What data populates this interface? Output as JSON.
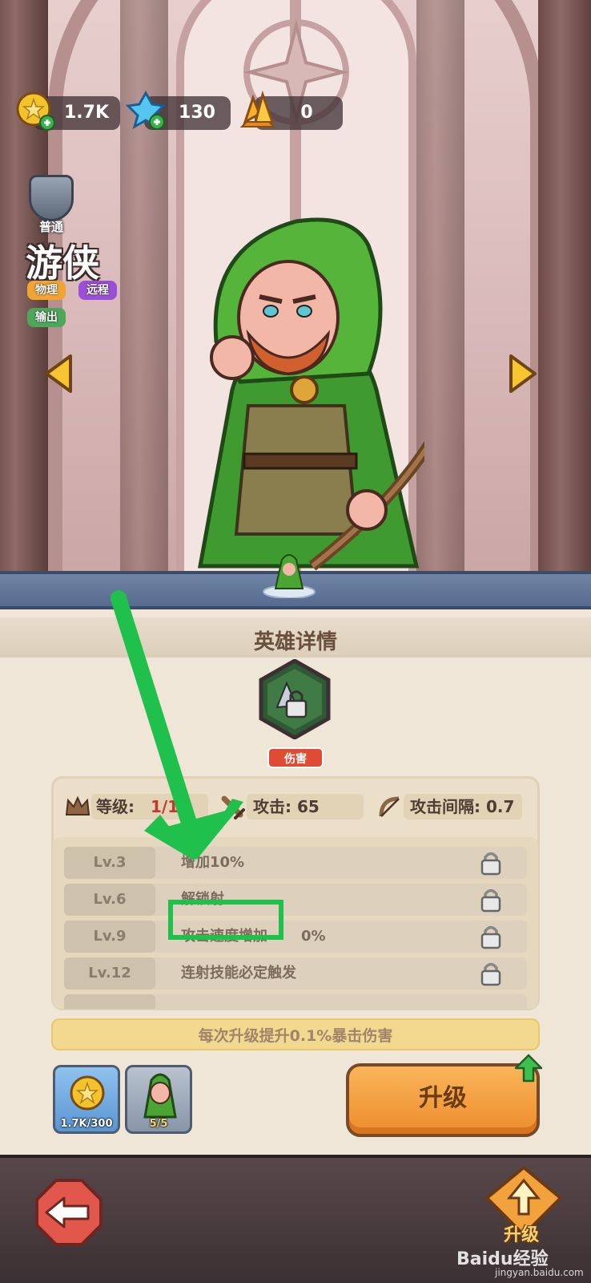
{
  "resources": {
    "gold": "1.7K",
    "gems": "130",
    "crystals": "0"
  },
  "hero": {
    "rank": "普通",
    "name": "游侠",
    "tags": [
      "物理",
      "远程",
      "输出"
    ]
  },
  "panel": {
    "title": "英雄详情",
    "skill_tag": "伤害",
    "stats": {
      "level_label": "等级:",
      "level_value": "1/1",
      "attack": "攻击: 65",
      "interval": "攻击间隔: 0.7"
    },
    "levels": [
      {
        "lv": "Lv.3",
        "desc": "增加10%"
      },
      {
        "lv": "Lv.6",
        "desc": "解锁射"
      },
      {
        "lv": "Lv.9",
        "desc": "攻击速度增加"
      },
      {
        "lv": "Lv.12",
        "desc": "连射技能必定触发"
      }
    ],
    "levels_suffix": "0%",
    "info": "每次升级提升0.1%暴击伤害",
    "cost_gold": "1.7K/300",
    "cost_cards": "5/5",
    "upgrade": "升级"
  },
  "bottom": {
    "star_label": "升级",
    "watermark": "Baidu经验",
    "watermark_sub": "jingyan.baidu.com"
  },
  "colors": {
    "accent_green": "#1fc04c",
    "upgrade_orange": "#ee8d2b",
    "tag_physical": "#f0a431",
    "tag_ranged": "#9b4fd6",
    "tag_output": "#4da65a"
  }
}
